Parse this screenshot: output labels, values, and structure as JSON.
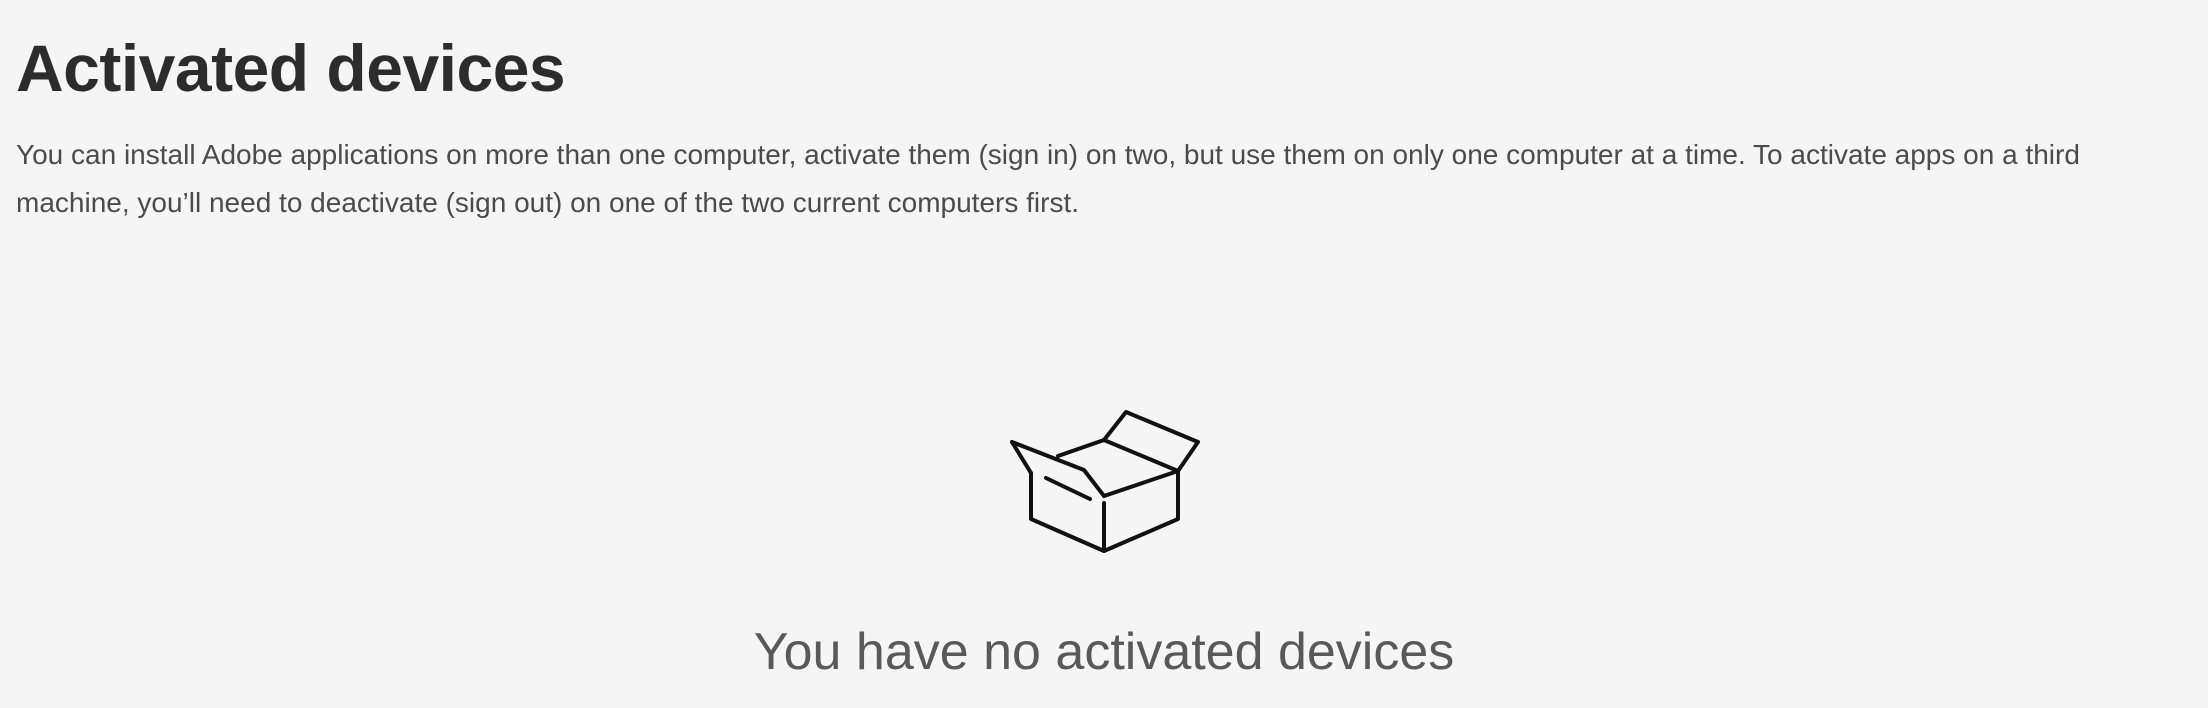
{
  "page": {
    "title": "Activated devices",
    "description": "You can install Adobe applications on more than one computer, activate them (sign in) on two, but use them on only one computer at a time. To activate apps on a third machine, you’ll need to deactivate (sign out) on one of the two current computers first."
  },
  "empty_state": {
    "icon": "open-box-icon",
    "message": "You have no activated devices"
  },
  "colors": {
    "background": "#f5f5f5",
    "title_text": "#2c2c2c",
    "body_text": "#4b4b4b",
    "empty_message_text": "#595959",
    "icon_stroke": "#111111"
  }
}
